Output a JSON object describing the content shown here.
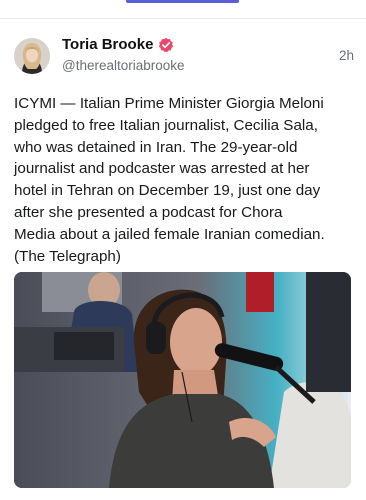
{
  "post": {
    "author_name": "Toria Brooke",
    "handle": "@therealtoriabrooke",
    "timestamp": "2h",
    "text": "ICYMI — Italian Prime Minister Giorgia Meloni\npledged to free Italian journalist, Cecilia Sala,\nwho was detained in Iran. The 29-year-old\njournalist and podcaster was arrested at her\nhotel in Tehran on December 19, just one day\nafter she presented a podcast for Chora\nMedia about a jailed female Iranian comedian.\n(The Telegraph)"
  },
  "colors": {
    "tab_indicator": "#5b5fd6",
    "verified_badge": "#e8486b",
    "secondary_text": "#6b6f76"
  },
  "icons": {
    "verified": "verified-badge-icon"
  }
}
